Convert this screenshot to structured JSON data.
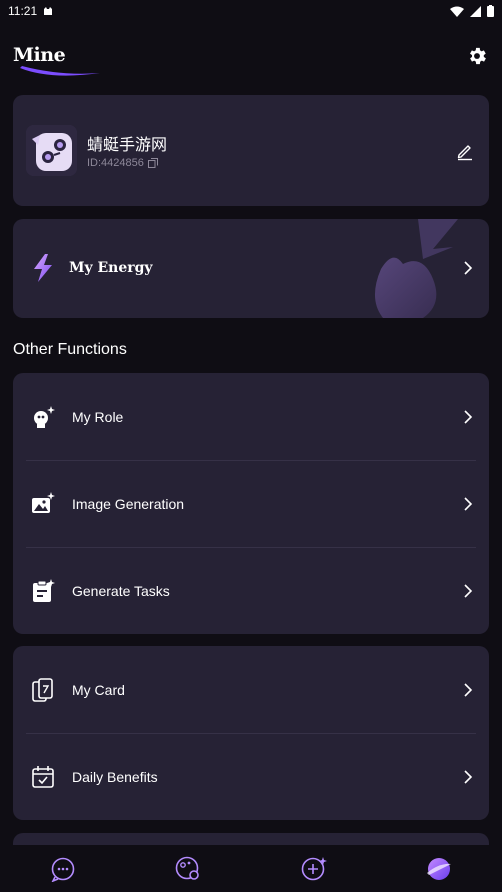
{
  "status": {
    "time": "11:21"
  },
  "header": {
    "title": "Mine"
  },
  "profile": {
    "name": "蜻蜓手游网",
    "id_text": "ID:4424856"
  },
  "energy": {
    "label": "My Energy"
  },
  "section": {
    "title": "Other Functions"
  },
  "functions": [
    {
      "label": "My Role",
      "icon": "role-icon"
    },
    {
      "label": "Image Generation",
      "icon": "image-generation-icon"
    },
    {
      "label": "Generate Tasks",
      "icon": "tasks-icon"
    }
  ],
  "extras": [
    {
      "label": "My Card",
      "icon": "card-icon"
    },
    {
      "label": "Daily Benefits",
      "icon": "calendar-icon"
    }
  ],
  "colors": {
    "accent": "#9b6bff",
    "card": "#262235",
    "background": "#0f0d14"
  }
}
